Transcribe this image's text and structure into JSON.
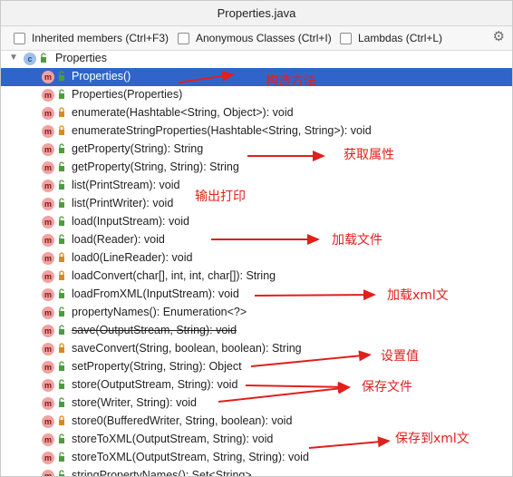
{
  "window": {
    "title": "Properties.java"
  },
  "toolbar": {
    "options": [
      {
        "label": "Inherited members (Ctrl+F3)",
        "checked": false
      },
      {
        "label": "Anonymous Classes (Ctrl+I)",
        "checked": false
      },
      {
        "label": "Lambdas (Ctrl+L)",
        "checked": false
      }
    ],
    "settings_icon": "gear-icon"
  },
  "tree": {
    "root": {
      "label": "Properties",
      "icon": "class-icon",
      "badge": "c"
    },
    "method_badge": "m",
    "items": [
      {
        "label": "Properties()",
        "visibility": "public",
        "selected": true
      },
      {
        "label": "Properties(Properties)",
        "visibility": "public"
      },
      {
        "label": "enumerate(Hashtable<String, Object>): void",
        "visibility": "private"
      },
      {
        "label": "enumerateStringProperties(Hashtable<String, String>): void",
        "visibility": "private"
      },
      {
        "label": "getProperty(String): String",
        "visibility": "public"
      },
      {
        "label": "getProperty(String, String): String",
        "visibility": "public"
      },
      {
        "label": "list(PrintStream): void",
        "visibility": "public"
      },
      {
        "label": "list(PrintWriter): void",
        "visibility": "public"
      },
      {
        "label": "load(InputStream): void",
        "visibility": "public"
      },
      {
        "label": "load(Reader): void",
        "visibility": "public"
      },
      {
        "label": "load0(LineReader): void",
        "visibility": "private"
      },
      {
        "label": "loadConvert(char[], int, int, char[]): String",
        "visibility": "private"
      },
      {
        "label": "loadFromXML(InputStream): void",
        "visibility": "public"
      },
      {
        "label": "propertyNames(): Enumeration<?>",
        "visibility": "public"
      },
      {
        "label": "save(OutputStream, String): void",
        "visibility": "public",
        "deprecated": true
      },
      {
        "label": "saveConvert(String, boolean, boolean): String",
        "visibility": "private"
      },
      {
        "label": "setProperty(String, String): Object",
        "visibility": "public"
      },
      {
        "label": "store(OutputStream, String): void",
        "visibility": "public"
      },
      {
        "label": "store(Writer, String): void",
        "visibility": "public"
      },
      {
        "label": "store0(BufferedWriter, String, boolean): void",
        "visibility": "private"
      },
      {
        "label": "storeToXML(OutputStream, String): void",
        "visibility": "public"
      },
      {
        "label": "storeToXML(OutputStream, String, String): void",
        "visibility": "public"
      },
      {
        "label": "stringPropertyNames(): Set<String>",
        "visibility": "public"
      }
    ]
  },
  "annotations": {
    "constructor": "构造方法",
    "get_property": "获取属性",
    "list_print": "输出打印",
    "load_file": "加载文件",
    "load_xml": "加载xml文",
    "set_value": "设置值",
    "save_file": "保存文件",
    "save_xml": "保存到xml文"
  },
  "colors": {
    "selection": "#2f65ca",
    "annotation": "#e0201c",
    "method_badge": "#f2a1a1",
    "class_badge": "#9fc1e8"
  }
}
